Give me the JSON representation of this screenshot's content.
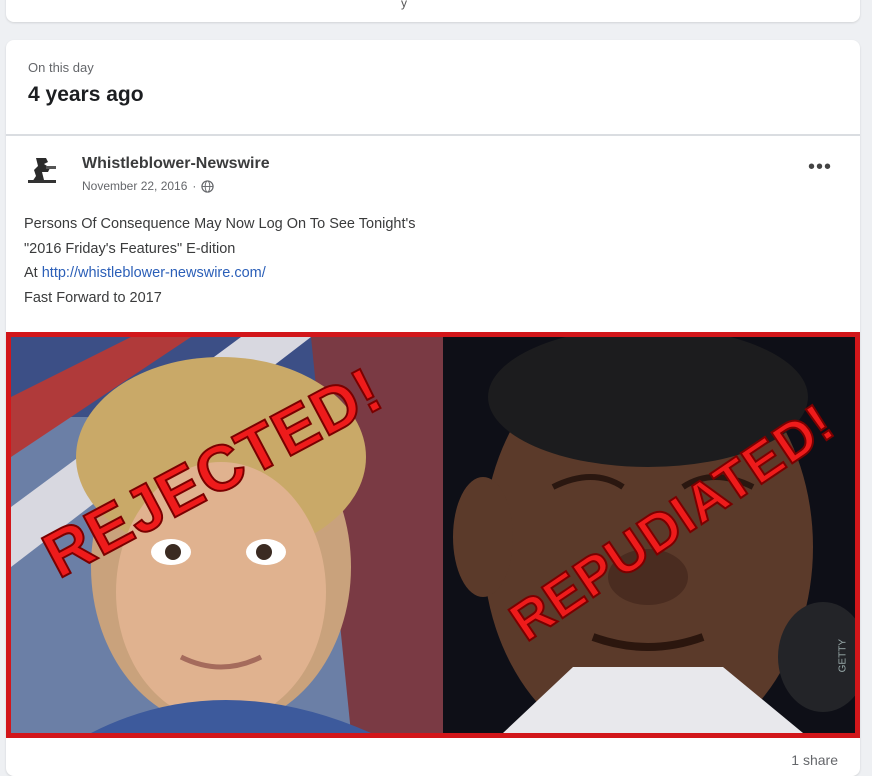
{
  "previous_card": {
    "glyph": "ÿ"
  },
  "memory": {
    "label": "On this day",
    "title": "4 years ago"
  },
  "post": {
    "page_name": "Whistleblower-Newswire",
    "date": "November 22, 2016",
    "separator": "·",
    "audience_icon": "globe-icon",
    "more_label": "•••",
    "text": {
      "line1": "Persons Of Consequence May Now Log On To See Tonight's",
      "line2": "\"2016 Friday's Features\" E-dition",
      "line3_prefix": "At ",
      "link": "http://whistleblower-newswire.com/",
      "line4": "Fast Forward to 2017"
    },
    "image": {
      "stamp_left": "REJECTED!",
      "stamp_right": "REPUDIATED!",
      "watermark": "GETTY",
      "frame_color": "#d2161a",
      "stamp_color": "#ee1b1b"
    },
    "shares": "1 share"
  }
}
